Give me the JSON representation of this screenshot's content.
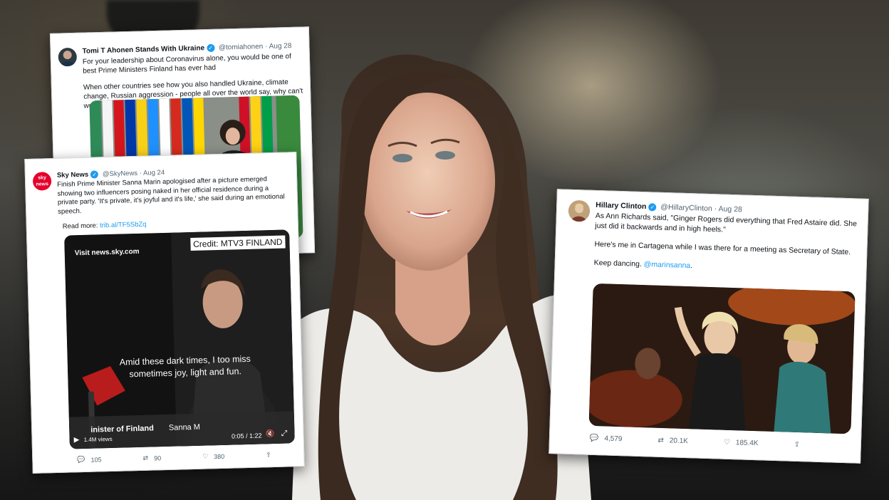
{
  "tweet1": {
    "name": "Tomi T Ahonen Stands With Ukraine",
    "handle": "@tomiahonen",
    "sep": "·",
    "date": "Aug 28",
    "text1": "For your leadership about Coronavirus alone, you would be one of best Prime Ministers Finland has ever had",
    "text2": "When other countries see how you also handled Ukraine, climate change, Russian aggression - people all over the world say, why can't we have leaders like Sanna Marin?"
  },
  "tweet2": {
    "avatar_text": "sky news",
    "name": "Sky News",
    "handle": "@SkyNews",
    "sep": "·",
    "date": "Aug 24",
    "text": "Finish Prime Minister Sanna Marin apologised after a picture emerged showing two influencers posing naked in her official residence during a private party. 'It's private, it's joyful and it's life,' she said during an emotional speech.",
    "read_more_label": "Read more:",
    "read_more_link": "trib.al/TF5SbZq",
    "video": {
      "watermark": "Visit news.sky.com",
      "credit": "Credit: MTV3 FINLAND",
      "subtitle_line1": "Amid these dark times, I too miss",
      "subtitle_line2": "sometimes joy, light and fun.",
      "lower_third": "inister of Finland",
      "lower_third_name": "Sanna M",
      "views": "1.4M views",
      "time": "0:05 / 1:22"
    },
    "replies": "105",
    "retweets": "90",
    "likes": "380"
  },
  "tweet3": {
    "name": "Hillary Clinton",
    "handle": "@HillaryClinton",
    "sep": "·",
    "date": "Aug 28",
    "text1": "As Ann Richards said, \"Ginger Rogers did everything that Fred Astaire did. She just did it backwards and in high heels.\"",
    "text2": "Here's me in Cartagena while I was there for a meeting as Secretary of State.",
    "text3_prefix": "Keep dancing. ",
    "mention": "@marinsanna",
    "text3_suffix": ".",
    "replies": "4,579",
    "retweets": "20.1K",
    "likes": "185.4K"
  },
  "colors": {
    "twitter_blue": "#1d9bf0",
    "sky_red": "#e4002b"
  }
}
